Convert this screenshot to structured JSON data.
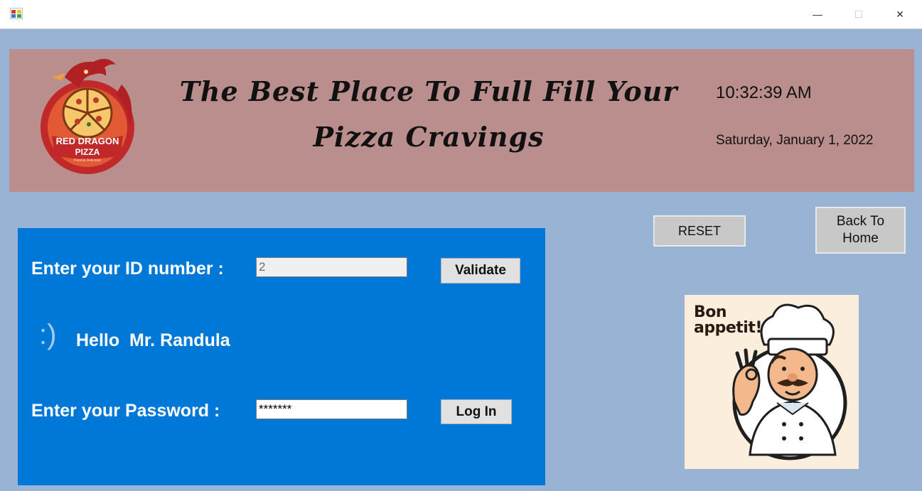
{
  "window": {
    "icon": "winforms-app-icon",
    "controls": {
      "minimize": "—",
      "maximize": "☐",
      "close": "✕"
    }
  },
  "banner": {
    "logo": {
      "line1": "RED DRAGON",
      "line2": "PIZZA",
      "tagline": "Food & Delicious"
    },
    "slogan_line1": "The Best Place To Full Fill Your",
    "slogan_line2": "Pizza Cravings",
    "time": "10:32:39 AM",
    "date": "Saturday, January 1, 2022"
  },
  "login": {
    "id_label": "Enter your ID number :",
    "id_value": "2",
    "validate_label": "Validate",
    "smiley": ":)",
    "greeting": "Hello  Mr. Randula",
    "password_label": "Enter your Password :",
    "password_value": "*******",
    "login_label": "Log In"
  },
  "actions": {
    "reset_label": "RESET",
    "home_line1": "Back To",
    "home_line2": "Home"
  },
  "chef_image": {
    "caption": "Bon appetit!",
    "caption_line1": "Bon",
    "caption_line2": "appetit!"
  },
  "colors": {
    "background": "#98b3d4",
    "banner": "#bb8e8e",
    "login_panel": "#0078d7",
    "button": "#e1e1e1"
  }
}
